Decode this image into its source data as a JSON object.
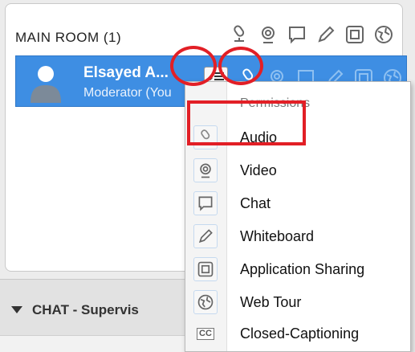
{
  "room": {
    "title": "MAIN ROOM (1)",
    "header_icons": [
      "microphone-icon",
      "webcam-icon",
      "chat-bubble-icon",
      "pencil-icon",
      "app-share-icon",
      "globe-icon"
    ]
  },
  "user": {
    "name": "Elsayed A...",
    "role": "Moderator (You",
    "row_icons": [
      "microphone-icon",
      "webcam-icon",
      "chat-bubble-icon",
      "pencil-icon",
      "app-share-icon",
      "globe-icon"
    ]
  },
  "chat": {
    "label": "CHAT - Supervis"
  },
  "permissions_menu": {
    "title": "Permissions",
    "items": [
      {
        "label": "Audio",
        "icon": "microphone-icon"
      },
      {
        "label": "Video",
        "icon": "webcam-icon"
      },
      {
        "label": "Chat",
        "icon": "chat-bubble-icon"
      },
      {
        "label": "Whiteboard",
        "icon": "pencil-icon"
      },
      {
        "label": "Application Sharing",
        "icon": "app-share-icon"
      },
      {
        "label": "Web Tour",
        "icon": "globe-icon"
      },
      {
        "label": "Closed-Captioning",
        "icon": "closed-caption-icon"
      }
    ],
    "cc_text": "CC"
  },
  "colors": {
    "selection": "#3e8ee3",
    "annotation": "#e21f26"
  }
}
